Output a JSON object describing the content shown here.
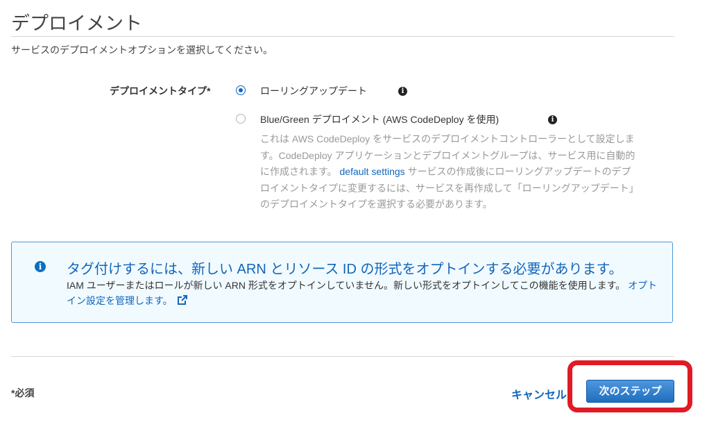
{
  "page": {
    "title": "デプロイメント",
    "subtitle": "サービスのデプロイメントオプションを選択してください。"
  },
  "deployment_type": {
    "label": "デプロイメントタイプ*",
    "options": [
      {
        "label": "ローリングアップデート",
        "checked": true
      },
      {
        "label": "Blue/Green デプロイメント (AWS CodeDeploy を使用)",
        "checked": false
      }
    ],
    "description": {
      "before_link": "これは AWS CodeDeploy をサービスのデプロイメントコントローラーとして設定します。CodeDeploy アプリケーションとデプロイメントグループは、サービス用に自動的に作成されます。",
      "link": "default settings",
      "after_link": "サービスの作成後にローリングアップデートのデプロイメントタイプに変更するには、サービスを再作成して「ローリングアップデート」のデプロイメントタイプを選択する必要があります。"
    }
  },
  "info_box": {
    "title": "タグ付けするには、新しい ARN とリソース ID の形式をオプトインする必要があります。",
    "body": "IAM ユーザーまたはロールが新しい ARN 形式をオプトインしていません。新しい形式をオプトインしてこの機能を使用します。",
    "link": "オプトイン設定を管理します。"
  },
  "footer": {
    "required_note": "*必須",
    "cancel_label": "キャンセル",
    "next_label": "次のステップ"
  },
  "colors": {
    "accent": "#1166bb",
    "annotation": "#e01b24"
  },
  "icons": {
    "info": "info-icon",
    "external_link": "external-link-icon"
  }
}
